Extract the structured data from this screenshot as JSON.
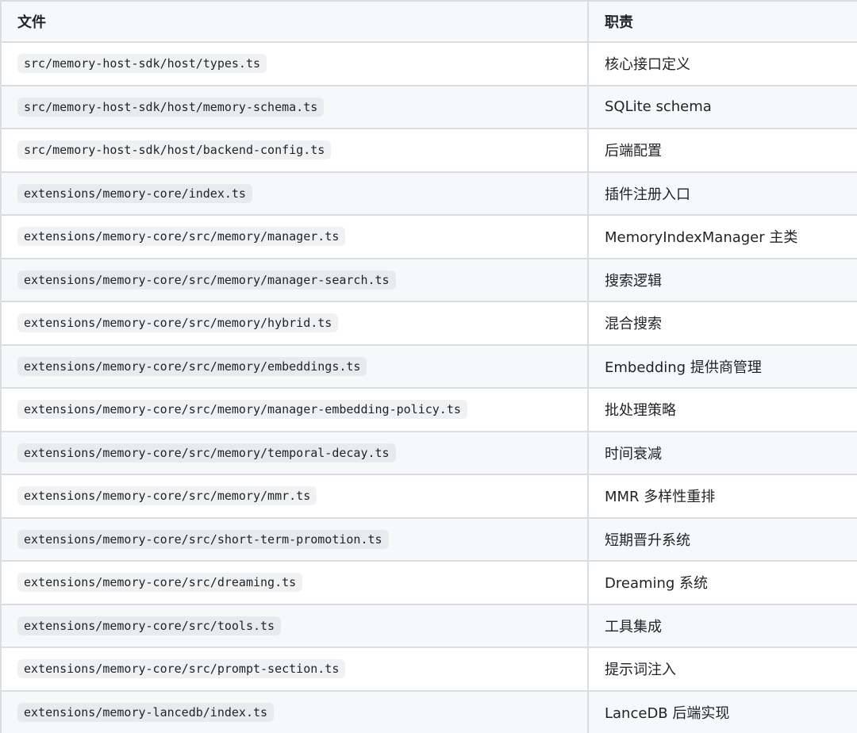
{
  "table": {
    "header": {
      "file": "文件",
      "role": "职责"
    },
    "rows": [
      {
        "file": "src/memory-host-sdk/host/types.ts",
        "role": "核心接口定义"
      },
      {
        "file": "src/memory-host-sdk/host/memory-schema.ts",
        "role": "SQLite schema"
      },
      {
        "file": "src/memory-host-sdk/host/backend-config.ts",
        "role": "后端配置"
      },
      {
        "file": "extensions/memory-core/index.ts",
        "role": "插件注册入口"
      },
      {
        "file": "extensions/memory-core/src/memory/manager.ts",
        "role": "MemoryIndexManager 主类"
      },
      {
        "file": "extensions/memory-core/src/memory/manager-search.ts",
        "role": "搜索逻辑"
      },
      {
        "file": "extensions/memory-core/src/memory/hybrid.ts",
        "role": "混合搜索"
      },
      {
        "file": "extensions/memory-core/src/memory/embeddings.ts",
        "role": "Embedding 提供商管理"
      },
      {
        "file": "extensions/memory-core/src/memory/manager-embedding-policy.ts",
        "role": "批处理策略"
      },
      {
        "file": "extensions/memory-core/src/memory/temporal-decay.ts",
        "role": "时间衰减"
      },
      {
        "file": "extensions/memory-core/src/memory/mmr.ts",
        "role": "MMR 多样性重排"
      },
      {
        "file": "extensions/memory-core/src/short-term-promotion.ts",
        "role": "短期晋升系统"
      },
      {
        "file": "extensions/memory-core/src/dreaming.ts",
        "role": "Dreaming 系统"
      },
      {
        "file": "extensions/memory-core/src/tools.ts",
        "role": "工具集成"
      },
      {
        "file": "extensions/memory-core/src/prompt-section.ts",
        "role": "提示词注入"
      },
      {
        "file": "extensions/memory-lancedb/index.ts",
        "role": "LanceDB 后端实现"
      }
    ]
  }
}
